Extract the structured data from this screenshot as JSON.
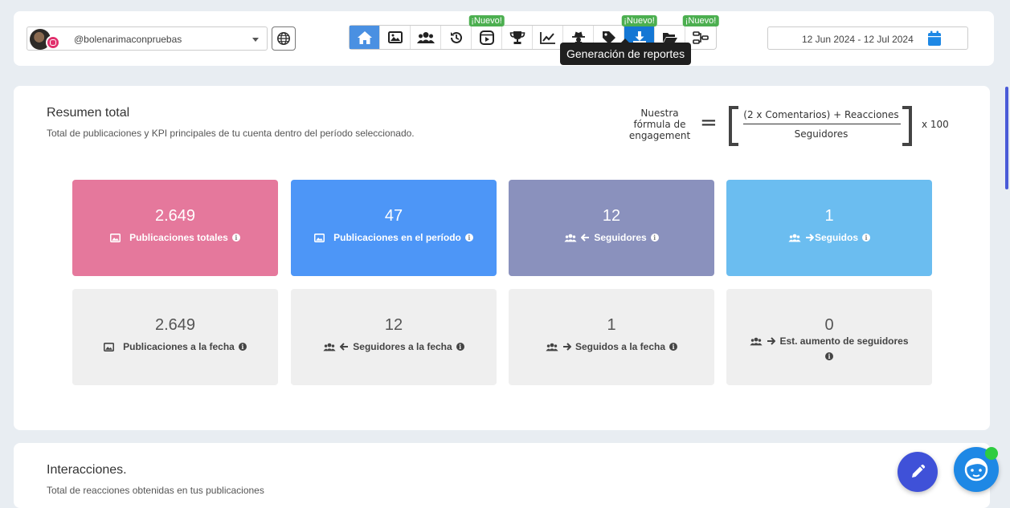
{
  "account": {
    "handle": "@bolenarimaconpruebas",
    "network_icon": "instagram-icon"
  },
  "nav": {
    "buttons": [
      {
        "icon": "home-icon",
        "badge": ""
      },
      {
        "icon": "image-icon",
        "badge": ""
      },
      {
        "icon": "users-icon",
        "badge": ""
      },
      {
        "icon": "history-icon",
        "badge": ""
      },
      {
        "icon": "reels-icon",
        "badge": "¡Nuevo!"
      },
      {
        "icon": "trophy-icon",
        "badge": ""
      },
      {
        "icon": "chart-line-icon",
        "badge": ""
      },
      {
        "icon": "spy-icon",
        "badge": ""
      },
      {
        "icon": "tag-icon",
        "badge": ""
      },
      {
        "icon": "download-icon",
        "badge": "¡Nuevo!"
      },
      {
        "icon": "folder-open-icon",
        "badge": ""
      },
      {
        "icon": "flow-icon",
        "badge": "¡Nuevo!"
      }
    ],
    "tooltip": "Generación de reportes"
  },
  "daterange": {
    "value": "12 Jun 2024 - 12 Jul 2024"
  },
  "summary": {
    "title": "Resumen total",
    "subtitle": "Total de publicaciones y KPI principales de tu cuenta dentro del período seleccionado.",
    "formula": {
      "label_line1": "Nuestra",
      "label_line2": "fórmula de",
      "label_line3": "engagement",
      "equals": "=",
      "numerator": "(2 x Comentarios) + Reacciones",
      "denominator": "Seguidores",
      "multiplier": "x 100"
    },
    "kpis_top": [
      {
        "value": "2.649",
        "label": "Publicaciones totales",
        "icon": "image-icon",
        "color": "#e5789c"
      },
      {
        "value": "47",
        "label": "Publicaciones en el período",
        "icon": "image-icon",
        "color": "#4d96f7"
      },
      {
        "value": "12",
        "label": "Seguidores",
        "icon": "users-arrow-left-icon",
        "color": "#8a91bd"
      },
      {
        "value": "1",
        "label": "Seguidos",
        "icon": "users-arrow-right-icon",
        "color": "#6bbdf0"
      }
    ],
    "kpis_bottom": [
      {
        "value": "2.649",
        "label": "Publicaciones a la fecha",
        "icon": "image-icon"
      },
      {
        "value": "12",
        "label": "Seguidores a la fecha",
        "icon": "users-arrow-left-icon"
      },
      {
        "value": "1",
        "label": "Seguidos a la fecha",
        "icon": "users-arrow-right-icon"
      },
      {
        "value": "0",
        "label": "Est. aumento de seguidores",
        "icon": "users-arrow-right-icon"
      }
    ]
  },
  "interactions": {
    "title": "Interacciones.",
    "subtitle": "Total de reacciones obtenidas en tus publicaciones"
  }
}
